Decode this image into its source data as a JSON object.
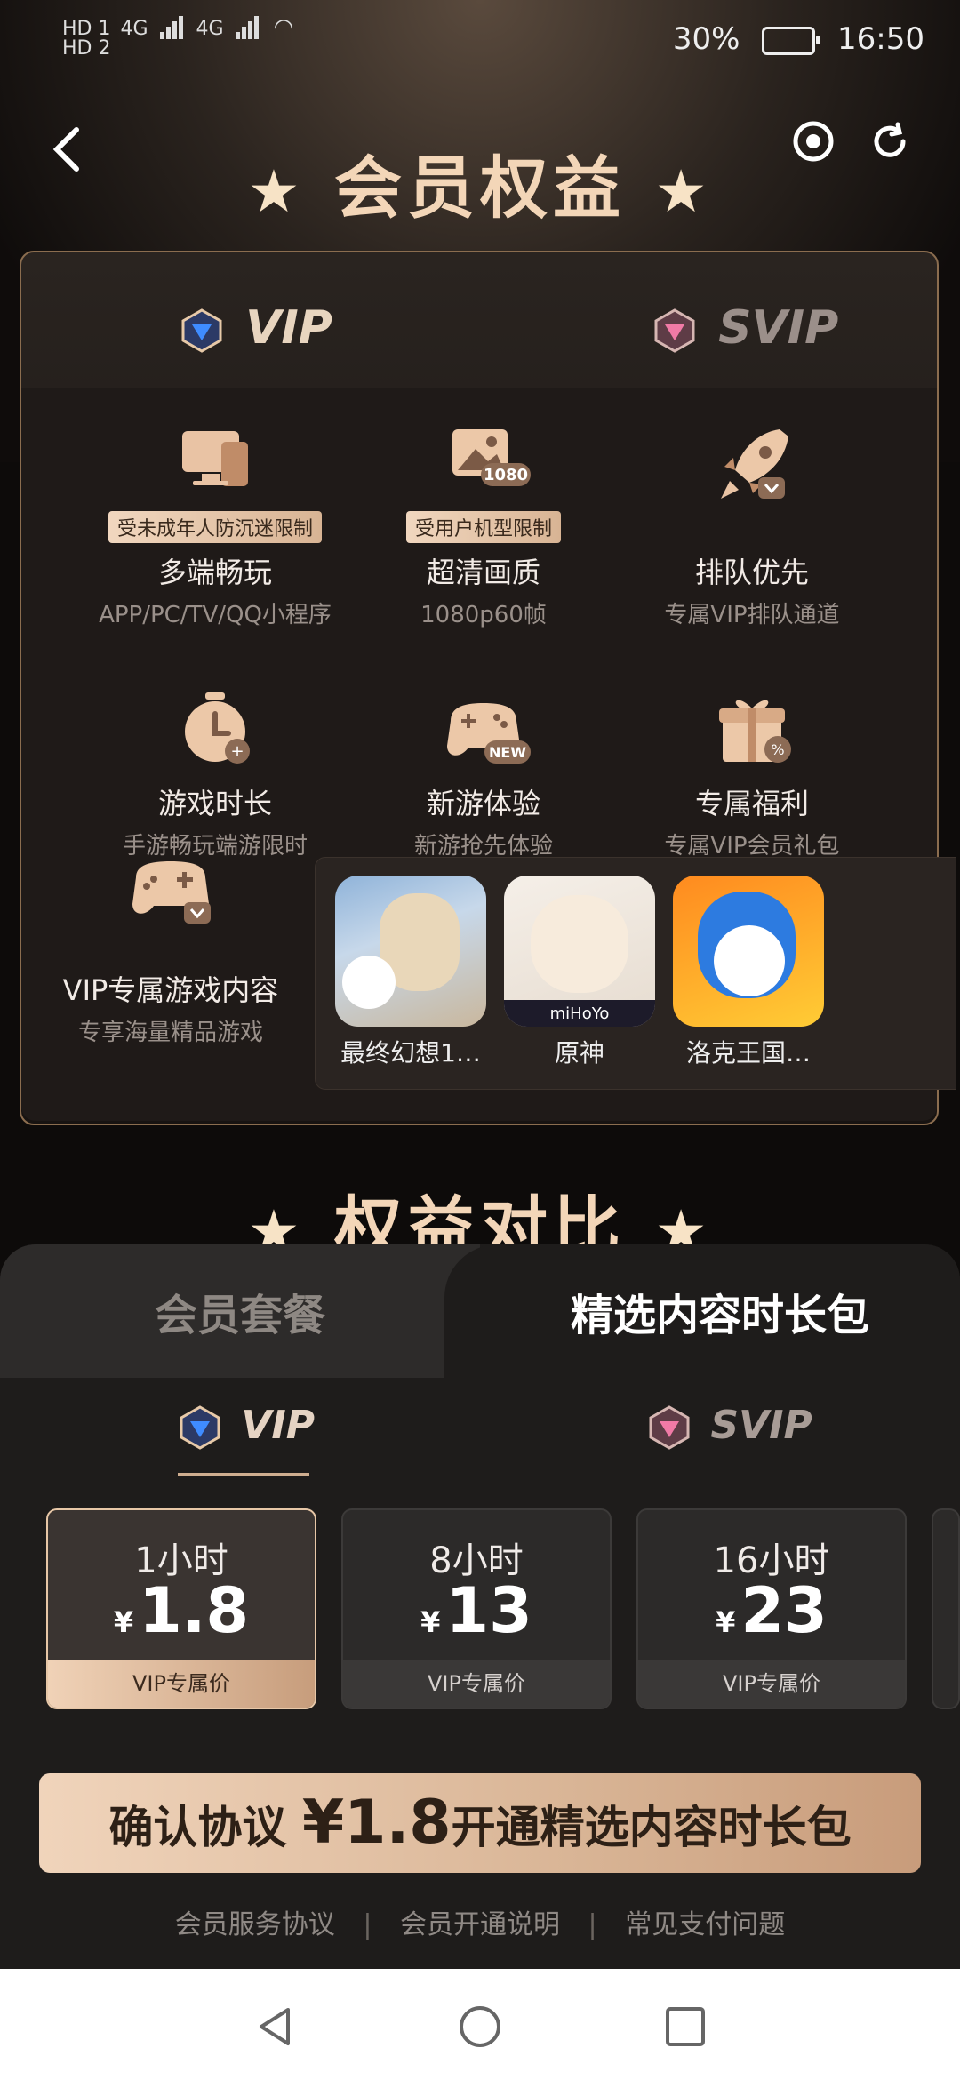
{
  "status_bar": {
    "hd_top": "HD 1",
    "hd_bottom": "HD 2",
    "net1": "4G",
    "net2": "4G",
    "battery": "30%",
    "time": "16:50"
  },
  "topbar": {
    "back_icon": "chevron-left-icon",
    "record_icon": "record-icon",
    "refresh_icon": "refresh-icon"
  },
  "hero": {
    "title": "会员权益",
    "star": "★"
  },
  "benefits": {
    "tiers": [
      {
        "label": "VIP",
        "active": true
      },
      {
        "label": "SVIP",
        "active": false
      }
    ],
    "items": [
      {
        "title": "多端畅玩",
        "subtitle": "APP/PC/TV/QQ小程序",
        "tag": "受未成年人防沉迷限制",
        "icon": "monitor-icon"
      },
      {
        "title": "超清画质",
        "subtitle": "1080p60帧",
        "tag": "受用户机型限制",
        "icon": "image-1080-icon",
        "badge": "1080"
      },
      {
        "title": "排队优先",
        "subtitle": "专属VIP排队通道",
        "tag": "",
        "icon": "rocket-icon"
      },
      {
        "title": "游戏时长",
        "subtitle": "手游畅玩端游限时",
        "tag": "",
        "icon": "stopwatch-icon"
      },
      {
        "title": "新游体验",
        "subtitle": "新游抢先体验",
        "tag": "",
        "icon": "gamepad-new-icon",
        "badge": "NEW"
      },
      {
        "title": "专属福利",
        "subtitle": "专属VIP会员礼包",
        "tag": "",
        "icon": "gift-icon"
      },
      {
        "title": "VIP专属游戏内容",
        "subtitle": "专享海量精品游戏",
        "tag": "",
        "icon": "gamepad-vip-icon"
      }
    ],
    "games": [
      {
        "name": "最终幻想1…"
      },
      {
        "name": "原神",
        "logo": "miHoYo"
      },
      {
        "name": "洛克王国…"
      }
    ]
  },
  "compare": {
    "title": "权益对比"
  },
  "sheet": {
    "tabs": [
      {
        "label": "会员套餐",
        "active": false
      },
      {
        "label": "精选内容时长包",
        "active": true
      }
    ],
    "tiers": [
      {
        "label": "VIP",
        "active": true
      },
      {
        "label": "SVIP",
        "active": false
      }
    ],
    "plans": [
      {
        "duration": "1小时",
        "currency": "¥",
        "price": "1.8",
        "note": "VIP专属价",
        "selected": true
      },
      {
        "duration": "8小时",
        "currency": "¥",
        "price": "13",
        "note": "VIP专属价",
        "selected": false
      },
      {
        "duration": "16小时",
        "currency": "¥",
        "price": "23",
        "note": "VIP专属价",
        "selected": false
      }
    ],
    "confirm": {
      "prefix": "确认协议",
      "amount": "¥1.8",
      "suffix": "开通精选内容时长包"
    },
    "links": [
      "会员服务协议",
      "会员开通说明",
      "常见支付问题"
    ],
    "link_separator": "|"
  },
  "navbar": {
    "back": "nav-back-icon",
    "home": "nav-home-icon",
    "recent": "nav-recent-icon"
  },
  "colors": {
    "gold": "#d7b08c",
    "background": "#0d0b0a",
    "sheet": "#1e1c1b"
  }
}
